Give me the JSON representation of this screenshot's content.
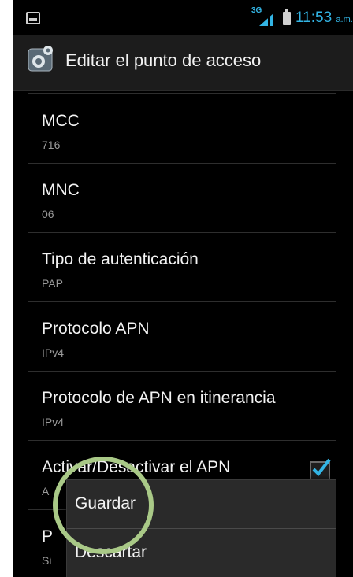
{
  "status_bar": {
    "network": "3G",
    "time": "11:53",
    "ampm": "a.m."
  },
  "action_bar": {
    "title": "Editar el punto de acceso",
    "icon": "settings-gear-icon"
  },
  "rows": [
    {
      "title": "MCC",
      "value": "716"
    },
    {
      "title": "MNC",
      "value": "06"
    },
    {
      "title": "Tipo de autenticación",
      "value": "PAP"
    },
    {
      "title": "Protocolo APN",
      "value": "IPv4"
    },
    {
      "title": "Protocolo de APN en itinerancia",
      "value": "IPv4"
    },
    {
      "title": "Activar/Desactivar el APN",
      "value": "A",
      "checked": true
    },
    {
      "title": "P",
      "value": "Si"
    }
  ],
  "menu": {
    "items": [
      {
        "label": "Guardar"
      },
      {
        "label": "Descartar"
      }
    ]
  },
  "colors": {
    "accent": "#33b5e5",
    "highlight": "#a9c987"
  }
}
